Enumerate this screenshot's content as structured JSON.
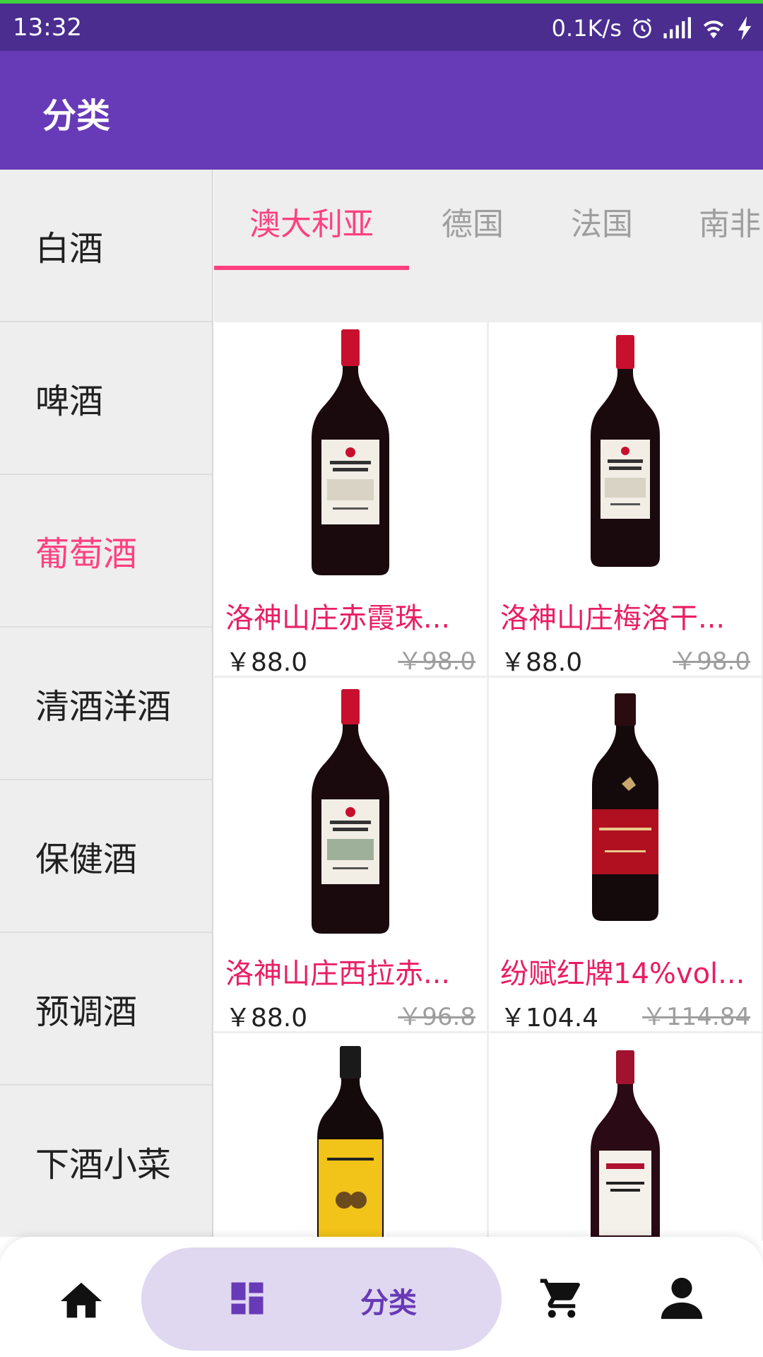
{
  "status_bar": {
    "time": "13:32",
    "speed": "0.1K/s",
    "icons": [
      "alarm-icon",
      "signal-icon",
      "wifi-icon",
      "charging-icon"
    ]
  },
  "app_bar": {
    "title": "分类"
  },
  "categories": [
    {
      "label": "白酒",
      "active": false
    },
    {
      "label": "啤酒",
      "active": false
    },
    {
      "label": "葡萄酒",
      "active": true
    },
    {
      "label": "清酒洋酒",
      "active": false
    },
    {
      "label": "保健酒",
      "active": false
    },
    {
      "label": "预调酒",
      "active": false
    },
    {
      "label": "下酒小菜",
      "active": false
    }
  ],
  "tabs": [
    {
      "label": "澳大利亚",
      "active": true
    },
    {
      "label": "德国",
      "active": false
    },
    {
      "label": "法国",
      "active": false
    },
    {
      "label": "南非",
      "active": false
    }
  ],
  "products": [
    {
      "name": "洛神山庄赤霞珠...",
      "price": "￥88.0",
      "old_price": "￥98.0",
      "image": "rawsons-retreat-bottle"
    },
    {
      "name": "洛神山庄梅洛干...",
      "price": "￥88.0",
      "old_price": "￥98.0",
      "image": "rawsons-retreat-bottle"
    },
    {
      "name": "洛神山庄西拉赤...",
      "price": "￥88.0",
      "old_price": "￥96.8",
      "image": "rawsons-retreat-bottle"
    },
    {
      "name": "纷赋红牌14%vol...",
      "price": "￥104.4",
      "old_price": "￥114.84",
      "image": "wolf-blass-red-bottle"
    },
    {
      "name": "",
      "price": "",
      "old_price": "",
      "image": "wolf-blass-yellow-bottle"
    },
    {
      "name": "",
      "price": "",
      "old_price": "",
      "image": "penfolds-koonunga-bottle"
    }
  ],
  "bottom_nav": {
    "items": [
      "home-icon",
      "category-icon",
      "cart-icon",
      "user-icon"
    ],
    "active_label": "分类"
  },
  "colors": {
    "primary": "#673ab7",
    "status_bar": "#4a2d8f",
    "accent": "#ff4081",
    "product_name": "#e91e63",
    "nav_pill": "#e0d8f1"
  }
}
